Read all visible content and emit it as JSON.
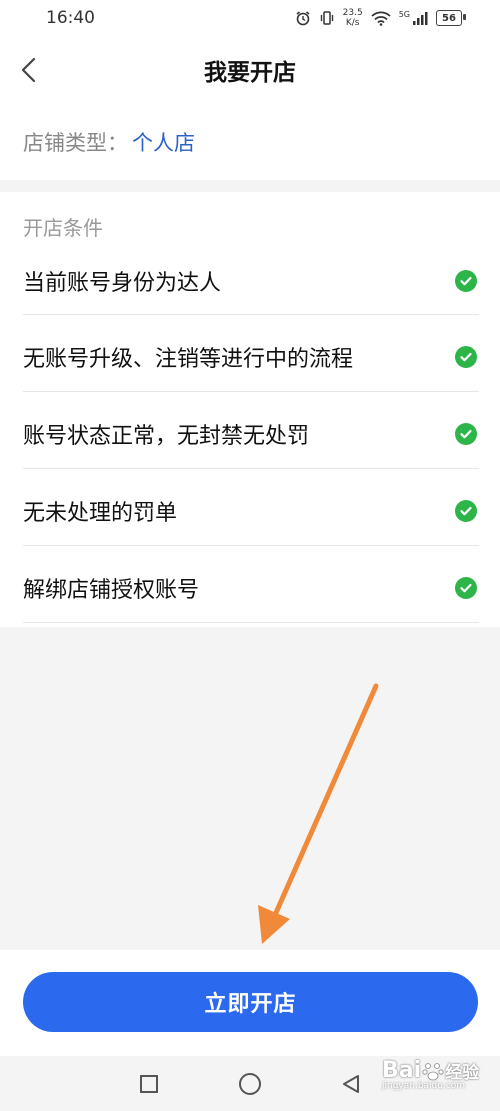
{
  "status_bar": {
    "time": "16:40",
    "net_speed_value": "23.5",
    "net_speed_unit": "K/s",
    "signal_label": "5G",
    "battery": "56"
  },
  "header": {
    "title": "我要开店"
  },
  "shop_type": {
    "label": "店铺类型：",
    "value": "个人店"
  },
  "conditions": {
    "heading": "开店条件",
    "items": [
      "当前账号身份为达人",
      "无账号升级、注销等进行中的流程",
      "账号状态正常，无封禁无处罚",
      "无未处理的罚单",
      "解绑店铺授权账号"
    ]
  },
  "action": {
    "open_shop_label": "立即开店"
  },
  "watermark": {
    "brand": "Bai",
    "suffix": "经验",
    "url": "jingyan.baidu.com"
  },
  "colors": {
    "accent": "#2b69ee",
    "link": "#2a62c9",
    "check": "#2db54a",
    "annotation_arrow": "#f08a3a"
  }
}
